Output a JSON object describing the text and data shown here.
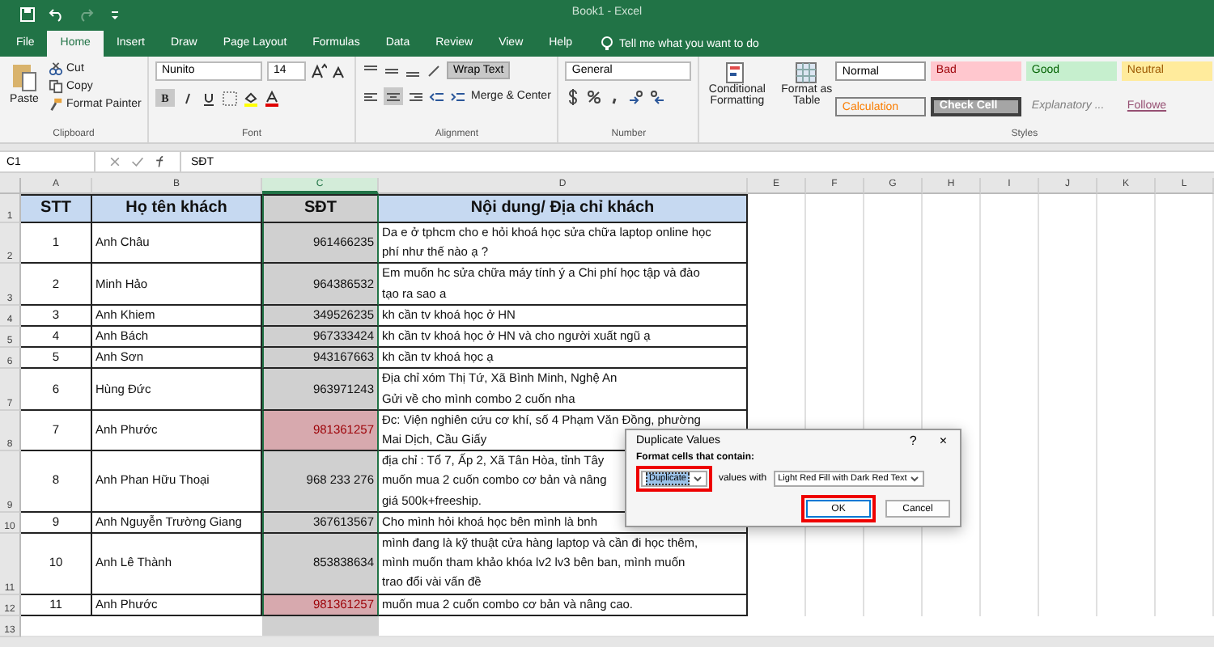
{
  "title_bar": {
    "title": "Book1 - Excel"
  },
  "tabs": [
    {
      "label": "File",
      "selected": false
    },
    {
      "label": "Home",
      "selected": true
    },
    {
      "label": "Insert",
      "selected": false
    },
    {
      "label": "Draw",
      "selected": false
    },
    {
      "label": "Page Layout",
      "selected": false
    },
    {
      "label": "Formulas",
      "selected": false
    },
    {
      "label": "Data",
      "selected": false
    },
    {
      "label": "Review",
      "selected": false
    },
    {
      "label": "View",
      "selected": false
    },
    {
      "label": "Help",
      "selected": false
    }
  ],
  "tell_me": {
    "placeholder": "Tell me what you want to do"
  },
  "ribbon": {
    "clipboard": {
      "paste": "Paste",
      "cut": "Cut",
      "copy": "Copy",
      "format_painter": "Format Painter",
      "label": "Clipboard"
    },
    "font": {
      "font_name": "Nunito",
      "font_size": "14",
      "bold": {
        "label": "B",
        "on": true
      },
      "label": "Font"
    },
    "alignment": {
      "wrap_text": {
        "label": "Wrap Text",
        "on": true
      },
      "merge": "Merge & Center",
      "center": true,
      "label": "Alignment"
    },
    "number": {
      "format": "General",
      "label": "Number"
    },
    "conditional_formatting": "Conditional Formatting",
    "format_as_table": "Format as Table",
    "styles": {
      "label": "Styles",
      "items": [
        {
          "label": "Normal",
          "kind": "normal"
        },
        {
          "label": "Bad",
          "kind": "bad"
        },
        {
          "label": "Good",
          "kind": "good"
        },
        {
          "label": "Neutral",
          "kind": "neutral"
        },
        {
          "label": "Calculation",
          "kind": "calculation"
        },
        {
          "label": "Check Cell",
          "kind": "check"
        },
        {
          "label": "Explanatory ...",
          "kind": "explanatory"
        },
        {
          "label": "Followe",
          "kind": "link"
        }
      ]
    }
  },
  "formula_bar": {
    "name_box": "C1",
    "formula": "SĐT"
  },
  "sheet": {
    "columns": [
      {
        "label": "A",
        "selected": false
      },
      {
        "label": "B",
        "selected": false
      },
      {
        "label": "C",
        "selected": true
      },
      {
        "label": "D",
        "selected": false
      },
      {
        "label": "E",
        "selected": false
      },
      {
        "label": "F",
        "selected": false
      },
      {
        "label": "G",
        "selected": false
      },
      {
        "label": "H",
        "selected": false
      },
      {
        "label": "I",
        "selected": false
      },
      {
        "label": "J",
        "selected": false
      },
      {
        "label": "K",
        "selected": false
      },
      {
        "label": "L",
        "selected": false
      }
    ],
    "header_row": "1",
    "header": [
      "STT",
      "Họ tên khách",
      "SĐT",
      "Nội dung/ Địa chỉ khách"
    ],
    "rows": [
      {
        "row": "2",
        "stt": "1",
        "name": "Anh Châu",
        "phone": "961466235",
        "content": "Da e ở tphcm cho e hỏi khoá học sửa chữa laptop online học\nphí như thế nào ạ ?",
        "duplicate": false
      },
      {
        "row": "3",
        "stt": "2",
        "name": "Minh Hảo",
        "phone": "964386532",
        "content": "Em muốn hc sửa chữa máy tính ý a Chi phí học tập và đào\ntạo ra sao a",
        "duplicate": false
      },
      {
        "row": "4",
        "stt": "3",
        "name": "Anh Khiem",
        "phone": "349526235",
        "content": "kh cần tv khoá học ở HN",
        "duplicate": false
      },
      {
        "row": "5",
        "stt": "4",
        "name": "Anh Bách",
        "phone": "967333424",
        "content": "kh cần tv khoá học ở HN và cho người xuất ngũ ạ",
        "duplicate": false
      },
      {
        "row": "6",
        "stt": "5",
        "name": "Anh Sơn",
        "phone": "943167663",
        "content": "kh cần tv khoá học ạ",
        "duplicate": false
      },
      {
        "row": "7",
        "stt": "6",
        "name": "Hùng Đức",
        "phone": "963971243",
        "content": "Địa chỉ xóm Thị Tứ, Xã Bình Minh, Nghệ An\nGửi về cho mình combo 2 cuốn nha",
        "duplicate": false
      },
      {
        "row": "8",
        "stt": "7",
        "name": "Anh Phước",
        "phone": "981361257",
        "content": "Đc: Viện nghiên cứu cơ khí, số 4 Phạm Văn Đồng, phường\nMai Dịch, Cầu Giấy",
        "duplicate": true
      },
      {
        "row": "9",
        "stt": "8",
        "name": "Anh Phan Hữu Thoại",
        "phone": "968 233 276",
        "content": "địa chỉ : Tổ 7, Ấp 2, Xã Tân Hòa, tỉnh Tây\nmuốn mua 2 cuốn combo cơ bản và nâng\ngiá 500k+freeship.",
        "duplicate": false
      },
      {
        "row": "10",
        "stt": "9",
        "name": "Anh Nguyễn Trường Giang",
        "phone": "367613567",
        "content": "Cho mình hỏi khoá học bên mình là bnh",
        "duplicate": false
      },
      {
        "row": "11",
        "stt": "10",
        "name": "Anh Lê Thành",
        "phone": "853838634",
        "content": "mình đang là kỹ thuật cửa hàng laptop và cần đi học thêm,\nmình muốn tham khảo khóa lv2 lv3 bên ban, mình muốn\ntrao đổi vài vấn đề",
        "duplicate": false
      },
      {
        "row": "12",
        "stt": "11",
        "name": "Anh Phước",
        "phone": "981361257",
        "content": "muốn mua 2 cuốn combo cơ bản và nâng cao.",
        "duplicate": true
      }
    ],
    "empty_rows": [
      "13"
    ]
  },
  "dialog": {
    "title": "Duplicate Values",
    "help": "?",
    "close": "×",
    "prompt": "Format cells that contain:",
    "rule": "Duplicate",
    "values_with": "values with",
    "format": "Light Red Fill with Dark Red Text",
    "buttons": [
      {
        "label": "OK",
        "kind": "default"
      },
      {
        "label": "Cancel",
        "kind": "normal"
      }
    ]
  }
}
